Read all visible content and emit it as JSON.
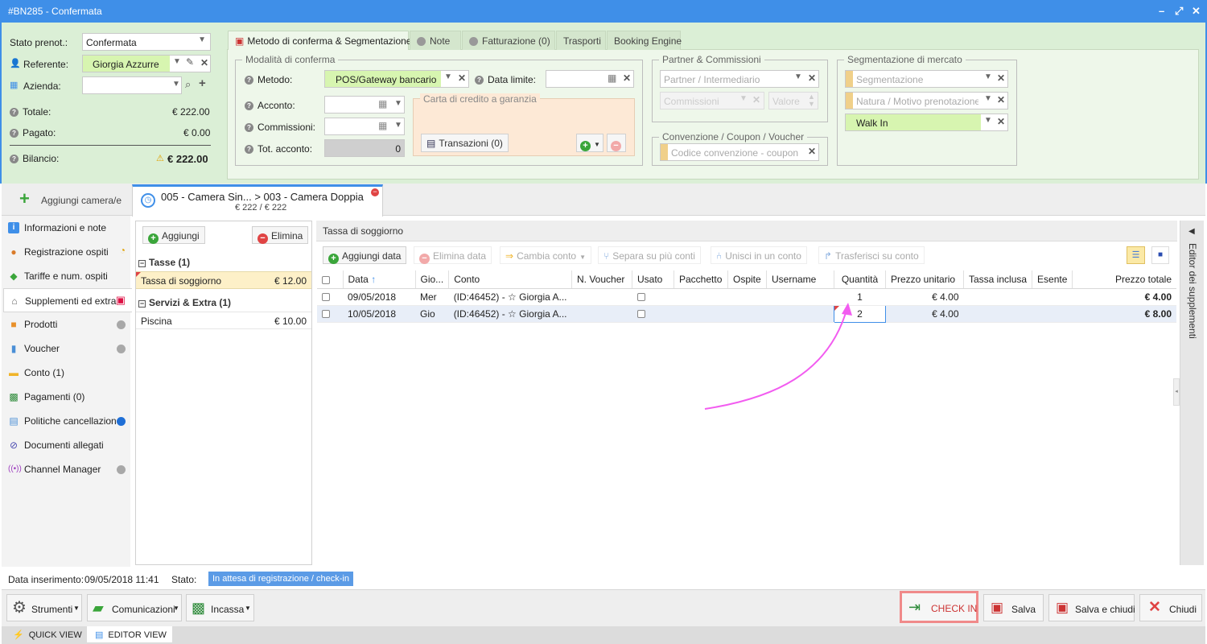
{
  "window": {
    "title": "#BN285 - Confermata",
    "controls": [
      "–",
      "⤢",
      "✕"
    ]
  },
  "left_form": {
    "stato_label": "Stato prenot.:",
    "stato_value": "Confermata",
    "referente_label": "Referente:",
    "referente_value": "Giorgia Azzurre",
    "azienda_label": "Azienda:",
    "azienda_value": "",
    "totale_label": "Totale:",
    "totale_value": "€ 222.00",
    "pagato_label": "Pagato:",
    "pagato_value": "€ 0.00",
    "bilancio_label": "Bilancio:",
    "bilancio_value": "€ 222.00"
  },
  "top_tabs": [
    {
      "label": "Metodo di conferma & Segmentazione"
    },
    {
      "label": "Note"
    },
    {
      "label": "Fatturazione (0)"
    },
    {
      "label": "Trasporti"
    },
    {
      "label": "Booking Engine"
    }
  ],
  "conferma": {
    "legend": "Modalità di conferma",
    "metodo_label": "Metodo:",
    "metodo_value": "POS/Gateway bancario",
    "data_limite_label": "Data limite:",
    "acconto_label": "Acconto:",
    "commissioni_label": "Commissioni:",
    "tot_acconto_label": "Tot. acconto:",
    "tot_acconto_value": "0",
    "carta_legend": "Carta di credito a garanzia",
    "transazioni_label": "Transazioni (0)"
  },
  "partner": {
    "legend": "Partner & Commissioni",
    "partner_placeholder": "Partner / Intermediario",
    "commissioni_placeholder": "Commissioni",
    "valore_placeholder": "Valore"
  },
  "convenzione": {
    "legend": "Convenzione / Coupon / Voucher",
    "placeholder": "Codice convenzione - coupon"
  },
  "segmentazione": {
    "legend": "Segmentazione di mercato",
    "seg_placeholder": "Segmentazione",
    "natura_placeholder": "Natura / Motivo prenotazione",
    "canale_value": "Walk In"
  },
  "room_bar": {
    "add_room": "Aggiungi camera/e",
    "room_tab_title": "005 - Camera Sin... > 003 - Camera Doppia",
    "room_tab_price": "€ 222 / € 222"
  },
  "leftnav": [
    {
      "label": "Informazioni e note",
      "icon": "info-icon"
    },
    {
      "label": "Registrazione ospiti",
      "icon": "user-icon"
    },
    {
      "label": "Tariffe e num. ospiti",
      "icon": "tag-icon"
    },
    {
      "label": "Supplementi ed extra",
      "icon": "bell-icon"
    },
    {
      "label": "Prodotti",
      "icon": "box-icon"
    },
    {
      "label": "Voucher",
      "icon": "voucher-icon"
    },
    {
      "label": "Conto (1)",
      "icon": "folder-icon"
    },
    {
      "label": "Pagamenti (0)",
      "icon": "money-icon"
    },
    {
      "label": "Politiche cancellazione",
      "icon": "document-icon"
    },
    {
      "label": "Documenti allegati",
      "icon": "paperclip-icon"
    },
    {
      "label": "Channel Manager",
      "icon": "broadcast-icon"
    }
  ],
  "extras": {
    "aggiungi": "Aggiungi",
    "elimina": "Elimina",
    "group1": "Tasse (1)",
    "item1_label": "Tassa di soggiorno",
    "item1_value": "€ 12.00",
    "group2": "Servizi & Extra (1)",
    "item2_label": "Piscina",
    "item2_value": "€ 10.00"
  },
  "detail": {
    "title": "Tassa di soggiorno",
    "toolbar": {
      "aggiungi_data": "Aggiungi data",
      "elimina_data": "Elimina data",
      "cambia_conto": "Cambia conto",
      "separa": "Separa su più conti",
      "unisci": "Unisci in un conto",
      "trasferisci": "Trasferisci su conto"
    },
    "columns": [
      "Data",
      "Gio...",
      "Conto",
      "N. Voucher",
      "Usato",
      "Pacchetto",
      "Ospite",
      "Username",
      "Quantità",
      "Prezzo unitario",
      "Tassa inclusa",
      "Esente",
      "Prezzo totale"
    ],
    "rows": [
      {
        "data": "09/05/2018",
        "giorno": "Mer",
        "conto": "(ID:46452) - ☆ Giorgia A...",
        "quantita": "1",
        "prezzo_unitario": "€ 4.00",
        "prezzo_totale": "€ 4.00"
      },
      {
        "data": "10/05/2018",
        "giorno": "Gio",
        "conto": "(ID:46452) - ☆ Giorgia A...",
        "quantita": "2",
        "prezzo_unitario": "€ 4.00",
        "prezzo_totale": "€ 8.00"
      }
    ]
  },
  "side_panel_label": "Editor dei supplementi",
  "status": {
    "inserimento_label": "Data inserimento:",
    "inserimento_value": "09/05/2018 11:41",
    "stato_label": "Stato:",
    "stato_value": "In attesa di registrazione / check-in"
  },
  "footer": {
    "strumenti": "Strumenti",
    "comunicazioni": "Comunicazioni",
    "incassa": "Incassa",
    "checkin": "CHECK IN",
    "salva": "Salva",
    "salva_chiudi": "Salva e chiudi",
    "chiudi": "Chiudi"
  },
  "bottom_tabs": {
    "quick_view": "QUICK VIEW",
    "editor_view": "EDITOR VIEW"
  },
  "colors": {
    "accent": "#3f8fe8",
    "green_bg": "#dbefd6",
    "highlight_row": "#e8eef8",
    "checkin_border": "#f08a8a",
    "arrow": "#f25cf0"
  }
}
